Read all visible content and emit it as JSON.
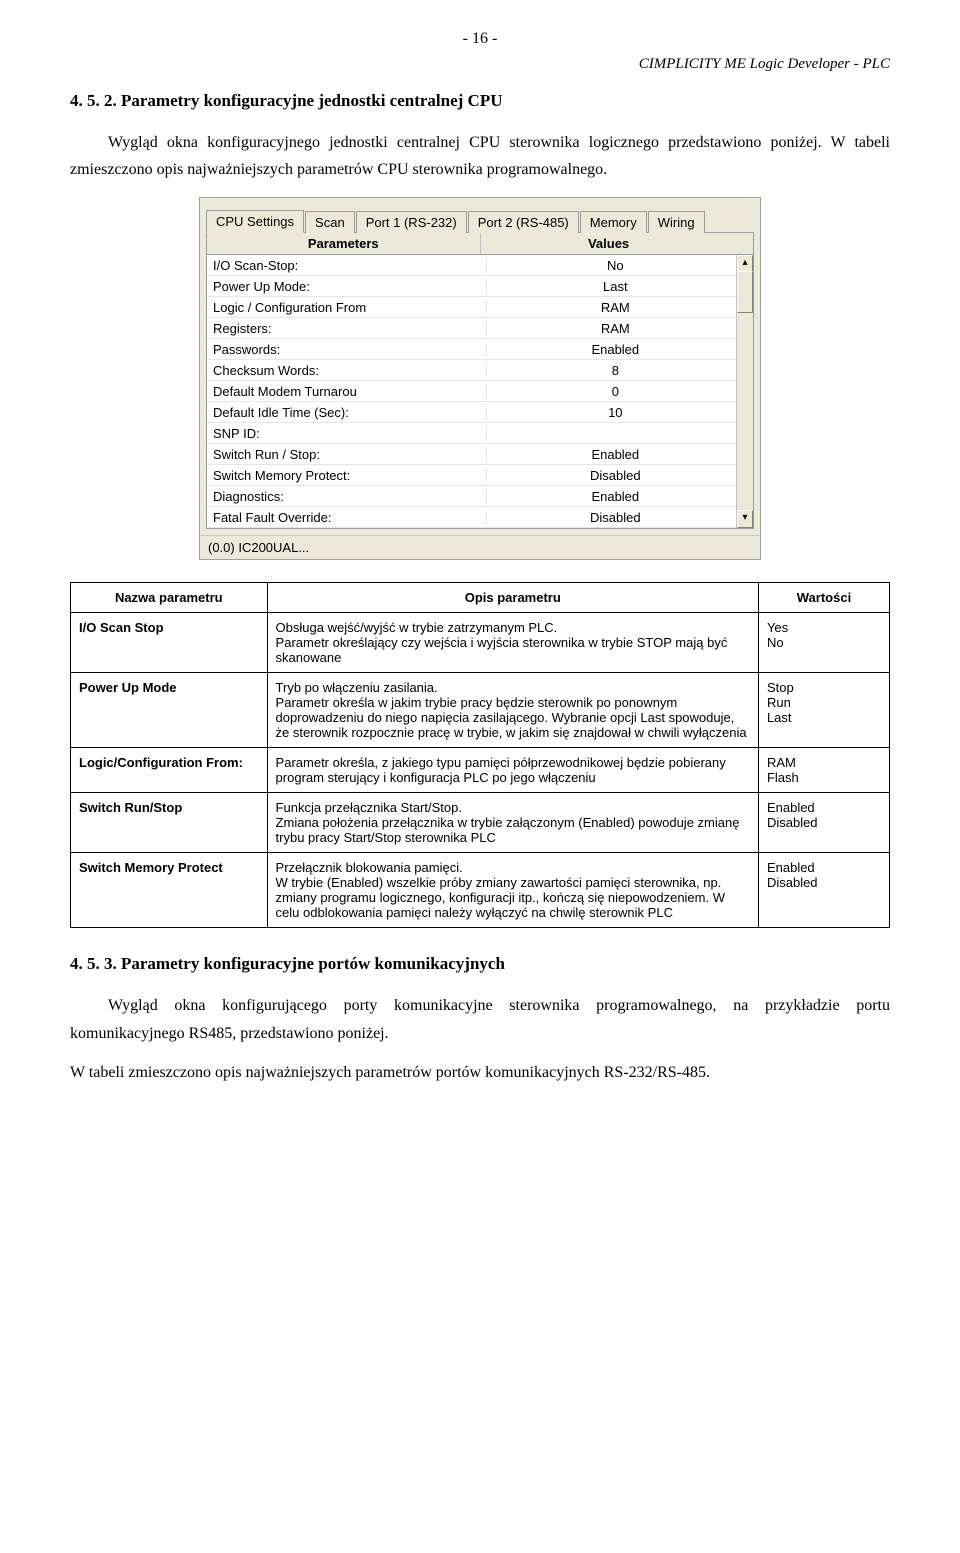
{
  "page_number": "- 16 -",
  "header": "CIMPLICITY ME Logic Developer - PLC",
  "section1": {
    "heading": "4. 5. 2. Parametry konfiguracyjne jednostki centralnej CPU",
    "p1": "Wygląd okna konfiguracyjnego jednostki centralnej CPU sterownika logicznego przedstawiono poniżej. W tabeli zmieszczono opis najważniejszych parametrów CPU sterownika programowalnego."
  },
  "window": {
    "tabs": [
      "CPU Settings",
      "Scan",
      "Port 1 (RS-232)",
      "Port 2 (RS-485)",
      "Memory",
      "Wiring"
    ],
    "active_tab": 0,
    "head_param": "Parameters",
    "head_value": "Values",
    "rows": [
      {
        "p": "I/O Scan-Stop:",
        "v": "No"
      },
      {
        "p": "Power Up Mode:",
        "v": "Last"
      },
      {
        "p": "Logic / Configuration From",
        "v": "RAM"
      },
      {
        "p": "Registers:",
        "v": "RAM"
      },
      {
        "p": "Passwords:",
        "v": "Enabled"
      },
      {
        "p": "Checksum Words:",
        "v": "8"
      },
      {
        "p": "Default Modem Turnarou",
        "v": "0"
      },
      {
        "p": "Default Idle Time (Sec):",
        "v": "10"
      },
      {
        "p": "SNP ID:",
        "v": ""
      },
      {
        "p": "Switch Run / Stop:",
        "v": "Enabled"
      },
      {
        "p": "Switch Memory Protect:",
        "v": "Disabled"
      },
      {
        "p": "Diagnostics:",
        "v": "Enabled"
      },
      {
        "p": "Fatal Fault Override:",
        "v": "Disabled"
      }
    ],
    "status": "(0.0) IC200UAL..."
  },
  "table": {
    "head_name": "Nazwa parametru",
    "head_desc": "Opis parametru",
    "head_vals": "Wartości",
    "rows": [
      {
        "name": "I/O Scan Stop",
        "desc": "Obsługa wejść/wyjść w trybie zatrzymanym PLC.\nParametr określający czy wejścia i wyjścia sterownika w trybie STOP mają być skanowane",
        "vals": "Yes\nNo"
      },
      {
        "name": "Power Up Mode",
        "desc": "Tryb po włączeniu zasilania.\nParametr określa w jakim trybie pracy będzie sterownik po ponownym doprowadzeniu do niego napięcia zasilającego. Wybranie opcji Last spowoduje, że sterownik rozpocznie pracę w trybie, w jakim się znajdował w chwili wyłączenia",
        "vals": "Stop\nRun\nLast"
      },
      {
        "name": "Logic/Configuration From:",
        "desc": "Parametr określa, z jakiego typu pamięci półprzewodnikowej będzie pobierany program sterujący i konfiguracja PLC po jego włączeniu",
        "vals": "RAM\nFlash"
      },
      {
        "name": "Switch Run/Stop",
        "desc": "Funkcja przełącznika Start/Stop.\nZmiana położenia przełącznika w trybie załączonym (Enabled) powoduje zmianę trybu pracy Start/Stop sterownika PLC",
        "vals": "Enabled\nDisabled"
      },
      {
        "name": "Switch Memory Protect",
        "desc": "Przełącznik blokowania pamięci.\nW trybie (Enabled) wszelkie próby zmiany zawartości pamięci sterownika, np. zmiany programu logicznego, konfiguracji itp., kończą się niepowodzeniem. W celu odblokowania pamięci należy wyłączyć na chwilę sterownik PLC",
        "vals": "Enabled\nDisabled"
      }
    ]
  },
  "section2": {
    "heading": "4. 5. 3. Parametry konfiguracyjne portów komunikacyjnych",
    "p1": "Wygląd okna konfigurującego porty komunikacyjne sterownika programowalnego, na przykładzie portu komunikacyjnego RS485, przedstawiono poniżej.",
    "p2": "W tabeli zmieszczono opis najważniejszych parametrów portów komunikacyjnych RS-232/RS-485."
  }
}
